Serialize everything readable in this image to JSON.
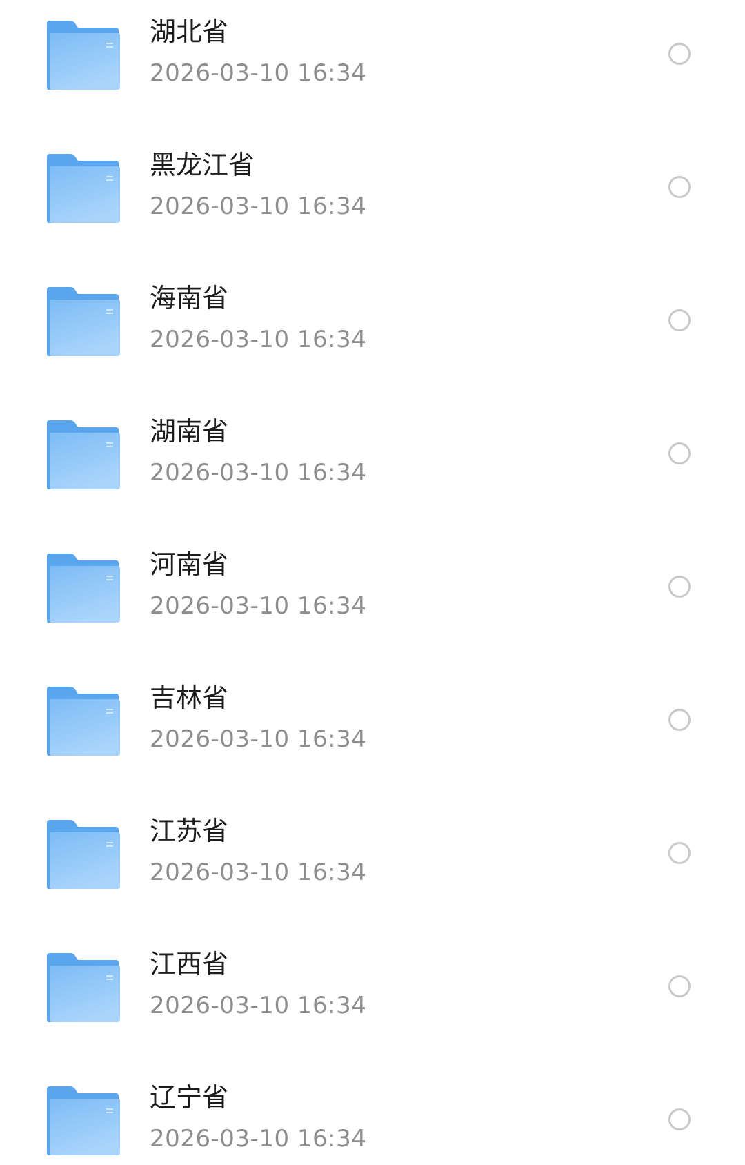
{
  "folders": [
    {
      "name": "湖北省",
      "date": "2026-03-10 16:34",
      "selected": false
    },
    {
      "name": "黑龙江省",
      "date": "2026-03-10 16:34",
      "selected": false
    },
    {
      "name": "海南省",
      "date": "2026-03-10 16:34",
      "selected": false
    },
    {
      "name": "湖南省",
      "date": "2026-03-10 16:34",
      "selected": false
    },
    {
      "name": "河南省",
      "date": "2026-03-10 16:34",
      "selected": false
    },
    {
      "name": "吉林省",
      "date": "2026-03-10 16:34",
      "selected": false
    },
    {
      "name": "江苏省",
      "date": "2026-03-10 16:34",
      "selected": false
    },
    {
      "name": "江西省",
      "date": "2026-03-10 16:34",
      "selected": false
    },
    {
      "name": "辽宁省",
      "date": "2026-03-10 16:34",
      "selected": false
    }
  ],
  "colors": {
    "folder_back": "#5aa6ee",
    "folder_front_top": "#7dbcf5",
    "folder_front_bottom": "#a9d4fb",
    "title_text": "#1d1d1d",
    "date_text": "#8e8e8e",
    "radio_border": "#c9c9c9"
  },
  "icons": {
    "folder": "folder-icon",
    "select": "radio-unchecked-icon"
  }
}
